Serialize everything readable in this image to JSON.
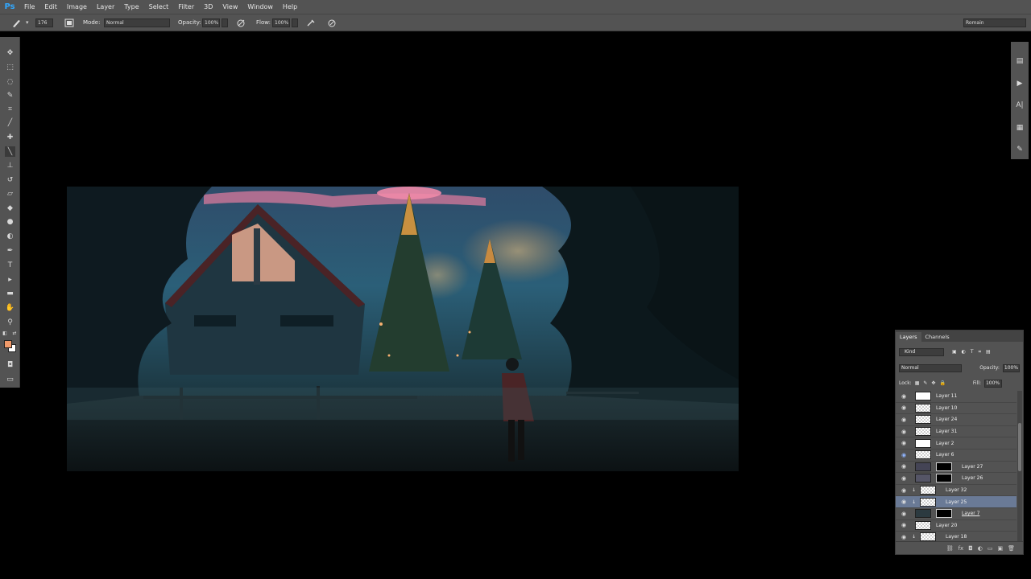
{
  "app": {
    "logo": "Ps"
  },
  "menu": [
    "File",
    "Edit",
    "Image",
    "Layer",
    "Type",
    "Select",
    "Filter",
    "3D",
    "View",
    "Window",
    "Help"
  ],
  "options": {
    "brush_size": "176",
    "mode_label": "Mode:",
    "mode_value": "Normal",
    "opacity_label": "Opacity:",
    "opacity_value": "100%",
    "flow_label": "Flow:",
    "flow_value": "100%",
    "workspace": "Romain"
  },
  "layers_panel": {
    "tabs": [
      "Layers",
      "Channels"
    ],
    "filter_kind": "Kind",
    "blend_mode": "Normal",
    "opacity_label": "Opacity:",
    "opacity_value": "100%",
    "lock_label": "Lock:",
    "fill_label": "Fill:",
    "fill_value": "100%",
    "layers": [
      {
        "name": "Layer 11"
      },
      {
        "name": "Layer 10"
      },
      {
        "name": "Layer 24"
      },
      {
        "name": "Layer 31"
      },
      {
        "name": "Layer 2"
      },
      {
        "name": "Layer 6"
      },
      {
        "name": "Layer 27"
      },
      {
        "name": "Layer 26"
      },
      {
        "name": "Layer 32"
      },
      {
        "name": "Layer 25"
      },
      {
        "name": "Layer 7"
      },
      {
        "name": "Layer 20"
      },
      {
        "name": "Layer 18"
      }
    ]
  },
  "colors": {
    "foreground": "#f09a6a",
    "background": "#ffffff",
    "selected_layer": "#6a7a96"
  }
}
